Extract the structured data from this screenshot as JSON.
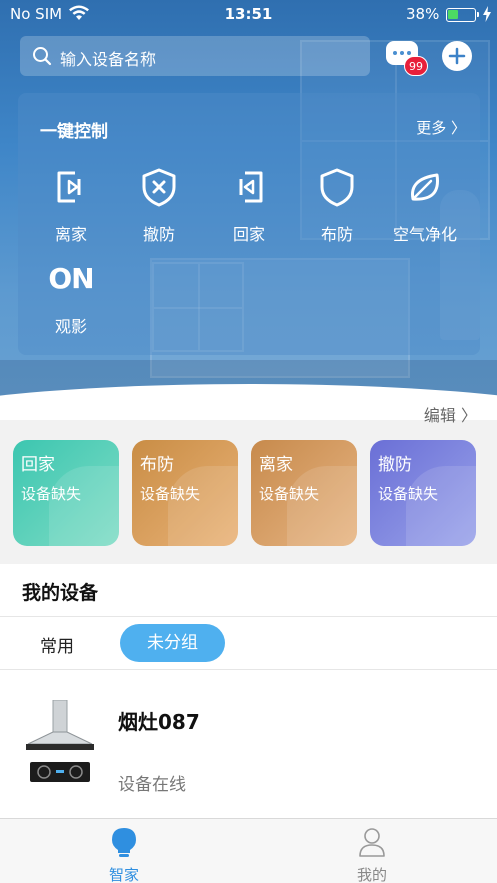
{
  "status_bar": {
    "carrier": "No SIM",
    "time": "13:51",
    "battery_text": "38%",
    "battery_level": 0.38
  },
  "search": {
    "placeholder": "输入设备名称"
  },
  "messages": {
    "badge": "99"
  },
  "quick_control": {
    "title": "一键控制",
    "more": "更多 〉",
    "items": [
      {
        "label": "离家",
        "icon": "leave-home-icon"
      },
      {
        "label": "撤防",
        "icon": "disarm-shield-icon"
      },
      {
        "label": "回家",
        "icon": "back-home-icon"
      },
      {
        "label": "布防",
        "icon": "arm-shield-icon"
      },
      {
        "label": "空气净化",
        "icon": "leaf-icon"
      },
      {
        "label": "观影",
        "icon_text": "ON"
      }
    ]
  },
  "edit": "编辑 〉",
  "scenes": [
    {
      "title": "回家",
      "subtitle": "设备缺失",
      "color_from": "#3cc6b0",
      "color_to": "#7fdcc5"
    },
    {
      "title": "布防",
      "subtitle": "设备缺失",
      "color_from": "#c98d45",
      "color_to": "#e9b277"
    },
    {
      "title": "离家",
      "subtitle": "设备缺失",
      "color_from": "#c78a4c",
      "color_to": "#e7b583"
    },
    {
      "title": "撤防",
      "subtitle": "设备缺失",
      "color_from": "#6a6fd6",
      "color_to": "#9aa3ea"
    }
  ],
  "devices": {
    "title": "我的设备",
    "tabs": [
      "常用",
      "未分组"
    ],
    "items": [
      {
        "name": "烟灶087",
        "status": "设备在线"
      }
    ]
  },
  "tab_bar": [
    {
      "label": "智家",
      "color": "#2f8fe0"
    },
    {
      "label": "我的",
      "color": "#888888"
    }
  ]
}
